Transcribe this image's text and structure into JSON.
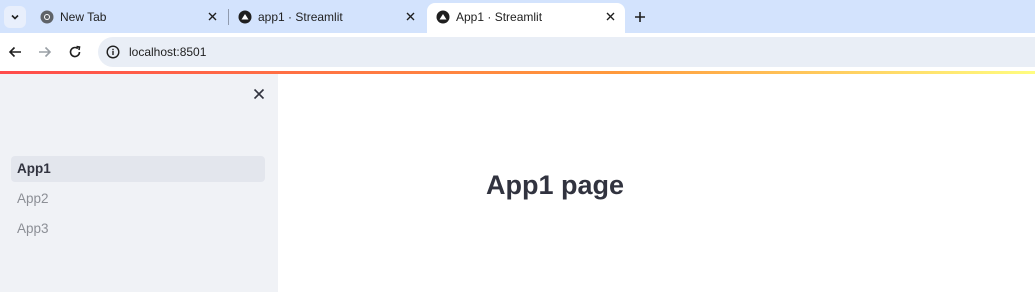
{
  "browser": {
    "tabs": [
      {
        "title": "New Tab",
        "icon": "chrome-icon",
        "active": false
      },
      {
        "title": "app1 · Streamlit",
        "icon": "streamlit-icon",
        "active": false
      },
      {
        "title": "App1 · Streamlit",
        "icon": "streamlit-icon",
        "active": true
      }
    ],
    "url": "localhost:8501"
  },
  "sidebar": {
    "items": [
      {
        "label": "App1",
        "active": true
      },
      {
        "label": "App2",
        "active": false
      },
      {
        "label": "App3",
        "active": false
      }
    ]
  },
  "main": {
    "title": "App1 page"
  },
  "colors": {
    "tabstrip": "#d3e3fd",
    "sidebar_bg": "#f0f2f6",
    "active_item_bg": "#e3e6ed",
    "text_dark": "#31333f",
    "text_muted": "#8c8f96",
    "accent_red": "#ff4b4b"
  }
}
